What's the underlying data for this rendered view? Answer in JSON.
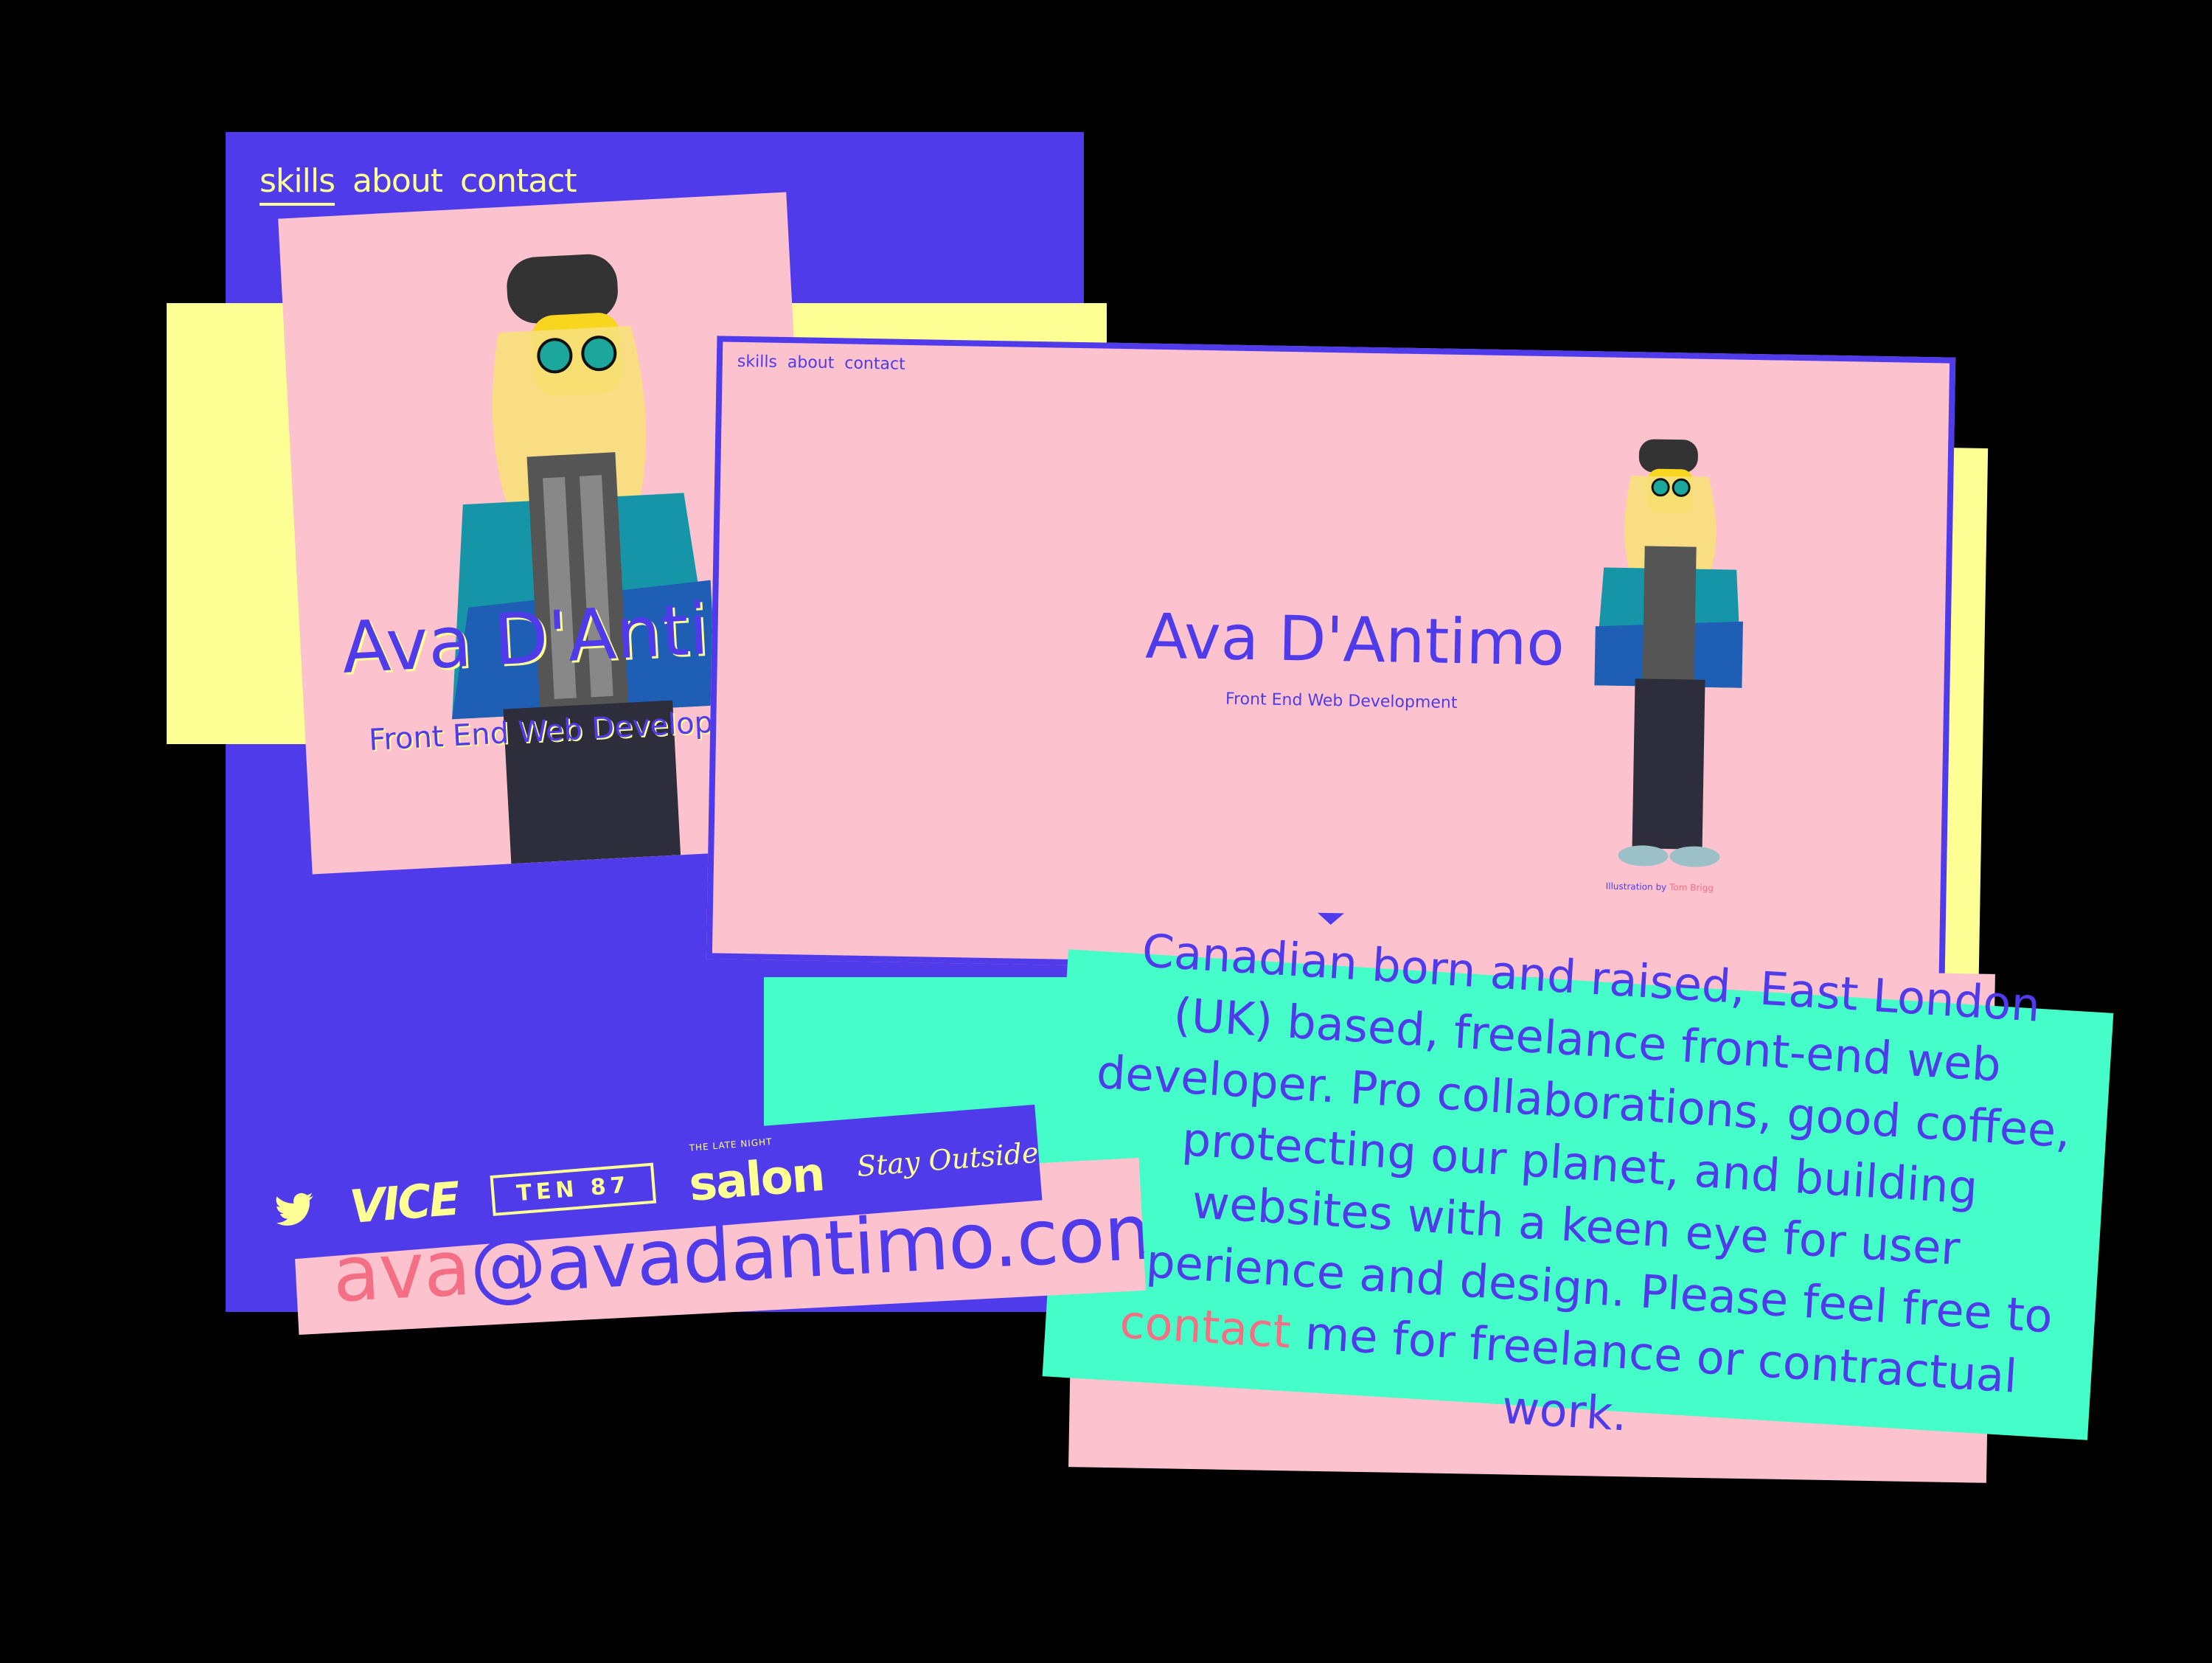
{
  "colors": {
    "background": "#000000",
    "blue": "#4F3BEA",
    "pink": "#FCC3CF",
    "yellow": "#FDFE93",
    "teal": "#45FDC8",
    "coral": "#F46E84"
  },
  "nav": {
    "skills": "skills",
    "about": "about",
    "contact": "contact"
  },
  "hero": {
    "name": "Ava D'Antimo",
    "subtitle": "Front End Web Development",
    "credit_prefix": "Illustration by ",
    "credit_name": "Tom Brigg"
  },
  "bio": {
    "before": "Canadian born and raised, East London (UK) based, freelance front-end web developer. Pro collaborations, good coffee, protecting our planet, and building websites with a keen eye for user experience and design. Please feel free to ",
    "link": "contact",
    "after": " me for freelance or contractual work."
  },
  "email": {
    "user": "ava",
    "domain": "@avadantimo.com"
  },
  "logos": {
    "twitter_icon": "twitter-icon",
    "vice": "VICE",
    "ten87": "TEN 87",
    "salon_pre": "THE LATE NIGHT",
    "salon": "salon",
    "stay_outside": "Stay Outside"
  }
}
